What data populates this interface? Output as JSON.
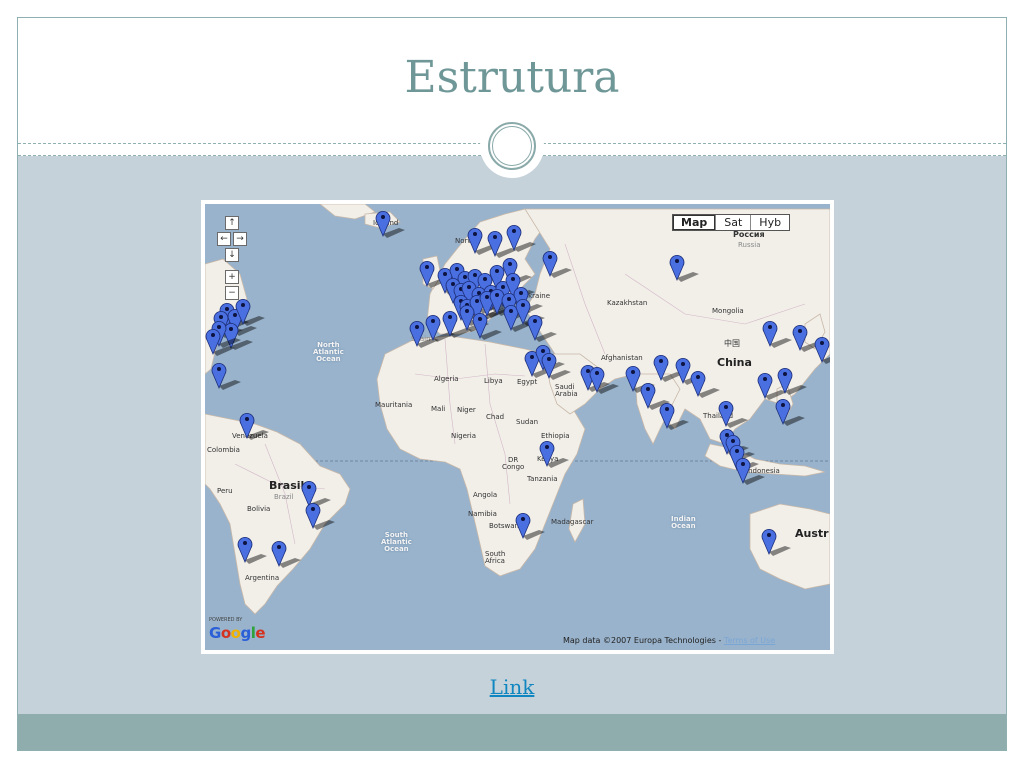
{
  "slide": {
    "title": "Estrutura",
    "link_label": "Link"
  },
  "colors": {
    "title": "#6f9797",
    "slide_body": "#c5d2da",
    "footer": "#8fadad",
    "ocean": "#99b3cc",
    "land": "#f2efe9",
    "marker": "#4a6fe0",
    "link": "#0f86bf"
  },
  "map": {
    "map_types": [
      "Map",
      "Sat",
      "Hyb"
    ],
    "active_map_type": "Map",
    "nav_controls": [
      "pan-up",
      "pan-left",
      "pan-right",
      "pan-down",
      "zoom-in",
      "zoom-out"
    ],
    "nav_glyphs": {
      "pan-up": "↑",
      "pan-left": "←",
      "pan-right": "→",
      "pan-down": "↓",
      "zoom-in": "+",
      "zoom-out": "−"
    },
    "powered_by": "POWERED BY",
    "logo": "Google",
    "attribution": "Map data ©2007 Europa Technologies - ",
    "terms_link": "Terms of Use",
    "labels": {
      "iceland": "Iceland",
      "norway": "Norway",
      "russia_native": "Россия",
      "russia": "Russia",
      "kazakhstan": "Kazakhstan",
      "mongolia": "Mongolia",
      "china_native": "中国",
      "china": "China",
      "north_atlantic": "North\nAtlantic\nOcean",
      "algeria": "Algeria",
      "libya": "Libya",
      "egypt": "Egypt",
      "saudi": "Saudi\nArabia",
      "mauritania": "Mauritania",
      "mali": "Mali",
      "niger": "Niger",
      "chad": "Chad",
      "sudan": "Sudan",
      "nigeria": "Nigeria",
      "ethiopia": "Ethiopia",
      "kenya": "Kenya",
      "dr_congo": "DR\nCongo",
      "tanzania": "Tanzania",
      "angola": "Angola",
      "namibia": "Namibia",
      "botswana": "Botswana",
      "madagascar": "Madagascar",
      "south_africa": "South\nAfrica",
      "venezuela": "Venezuela",
      "colombia": "Colombia",
      "peru": "Peru",
      "brasil": "Brasil",
      "brazil": "Brazil",
      "bolivia": "Bolivia",
      "argentina": "Argentina",
      "south_atlantic": "South\nAtlantic\nOcean",
      "indian_ocean": "Indian\nOcean",
      "thailand": "Thailand",
      "indonesia": "Indonesia",
      "australia": "Austr",
      "spain": "Spain",
      "ukraine": "Ukraine",
      "afghanistan": "Afghanistan"
    }
  }
}
